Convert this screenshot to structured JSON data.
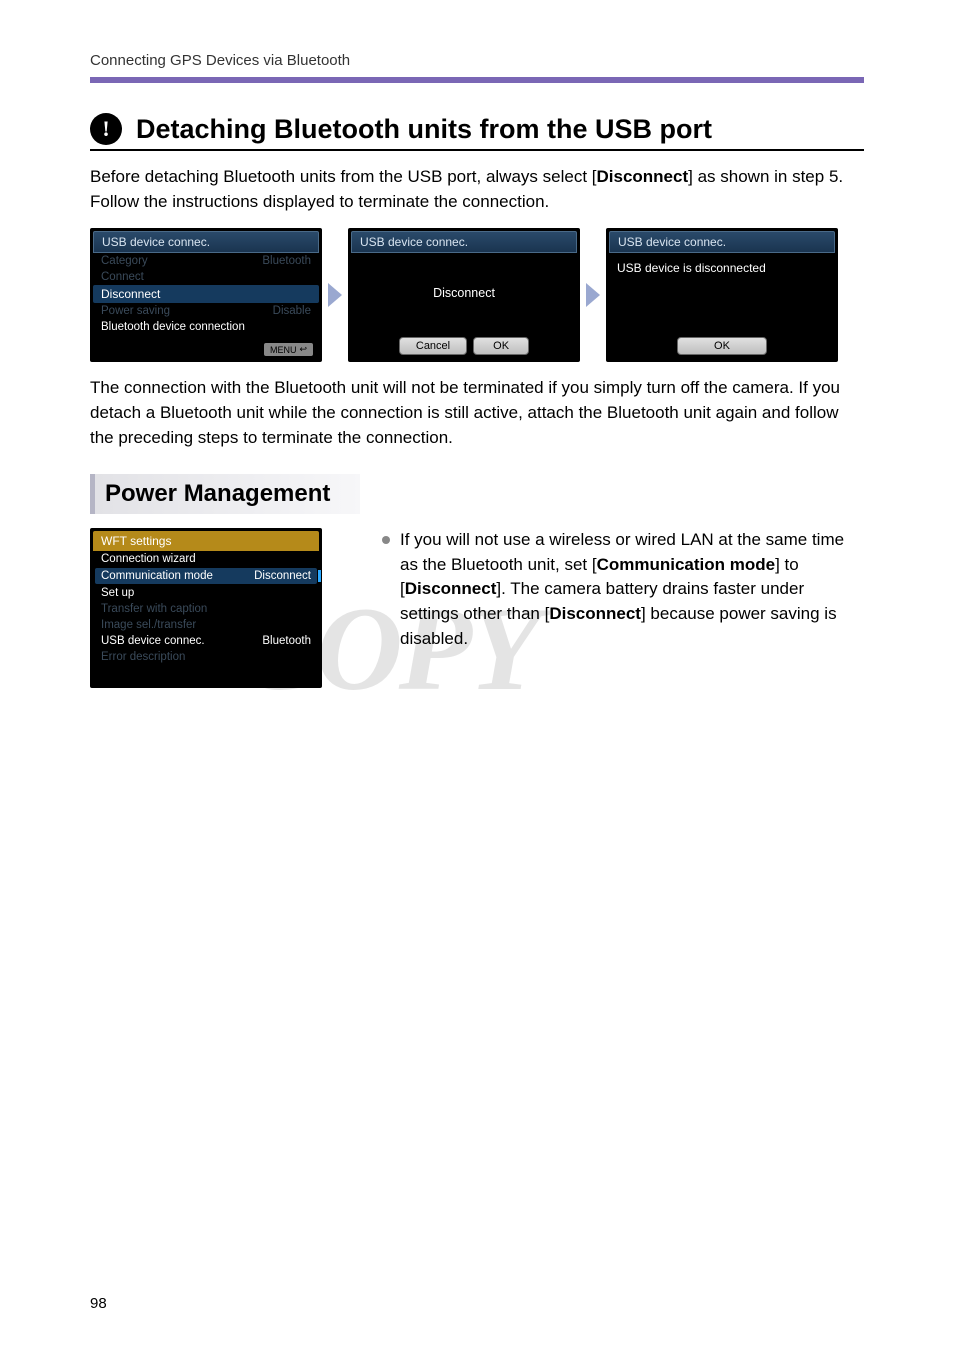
{
  "running_head": "Connecting GPS Devices via Bluetooth",
  "caution_title": "Detaching Bluetooth units from the USB port",
  "intro_text_pre": "Before detaching Bluetooth units from the USB port, always select [",
  "intro_text_bold": "Disconnect",
  "intro_text_post": "] as shown in step 5. Follow the instructions displayed to terminate the connection.",
  "screen1": {
    "title": "USB device connec.",
    "rows": [
      {
        "label": "Category",
        "value": "Bluetooth",
        "dim": true
      },
      {
        "label": "Connect",
        "value": "",
        "dim": true
      },
      {
        "label": "Disconnect",
        "value": "",
        "dim": false,
        "highlight": true
      },
      {
        "label": "Power saving",
        "value": "Disable",
        "dim": true
      },
      {
        "label": "Bluetooth device connection",
        "value": "",
        "dim": false
      }
    ],
    "menu": "MENU"
  },
  "screen2": {
    "title": "USB device connec.",
    "center": "Disconnect",
    "buttons": [
      "Cancel",
      "OK"
    ]
  },
  "screen3": {
    "title": "USB device connec.",
    "message": "USB device is disconnected",
    "buttons": [
      "OK"
    ]
  },
  "post_screens_text": "The connection with the Bluetooth unit will not be terminated if you simply turn off the camera. If you detach a Bluetooth unit while the connection is still active, attach the Bluetooth unit again and follow the preceding steps to terminate the connection.",
  "sub_heading": "Power Management",
  "wft": {
    "title": "WFT settings",
    "rows": [
      {
        "label": "Connection wizard",
        "value": "",
        "dim": false
      },
      {
        "label": "Communication mode",
        "value": "Disconnect",
        "dim": false,
        "comm": true
      },
      {
        "label": "Set up",
        "value": "",
        "dim": false
      },
      {
        "label": "Transfer with caption",
        "value": "",
        "dim": true
      },
      {
        "label": "Image sel./transfer",
        "value": "",
        "dim": true
      },
      {
        "label": "USB device connec.",
        "value": "Bluetooth",
        "dim": false
      },
      {
        "label": "Error description",
        "value": "",
        "dim": true
      }
    ]
  },
  "bullet": {
    "p1": "If you will not use a wireless or wired LAN at the same time as the Bluetooth unit, set [",
    "b1": "Communication mode",
    "p2": "] to [",
    "b2": "Disconnect",
    "p3": "]. The camera battery drains faster under settings other than [",
    "b3": "Disconnect",
    "p4": "] because power saving is disabled."
  },
  "watermark": "COPY",
  "page_number": "98"
}
